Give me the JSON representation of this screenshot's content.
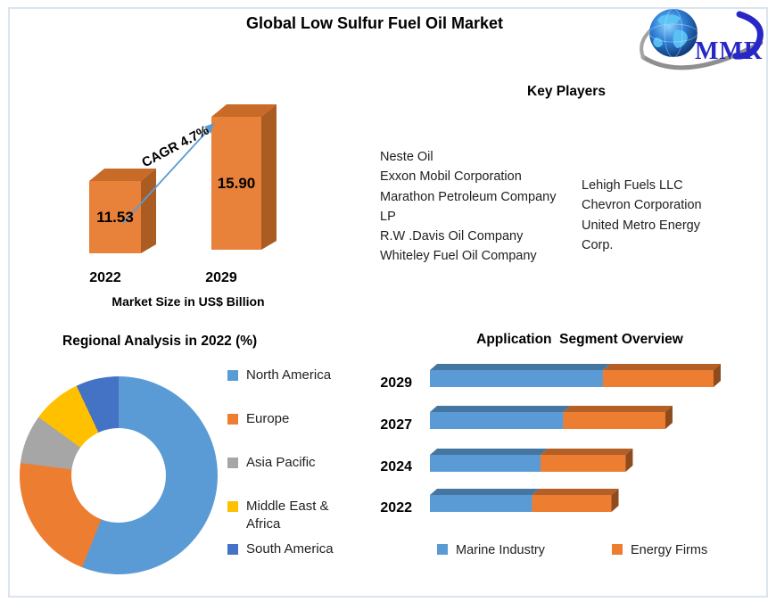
{
  "title": "Global Low Sulfur Fuel Oil Market",
  "logo": {
    "text": "MMR"
  },
  "colors": {
    "bar_front": "#e8813a",
    "bar_top": "#c86a28",
    "bar_side": "#ab5c22",
    "arrow": "#5b9bd5",
    "border": "#dbe4f0",
    "logo_blue": "#2727c8"
  },
  "key_players": {
    "heading": "Key Players",
    "left": [
      "Neste Oil",
      "Exxon Mobil Corporation",
      "Marathon Petroleum Company LP",
      "R.W .Davis Oil Company",
      "Whiteley Fuel Oil Company"
    ],
    "right": [
      "Lehigh Fuels LLC",
      "Chevron Corporation",
      "United Metro Energy Corp."
    ]
  },
  "chart_data": [
    {
      "type": "bar",
      "title": "Market Size in US$ Billion",
      "categories": [
        "2022",
        "2029"
      ],
      "values": [
        11.53,
        15.9
      ],
      "value_labels": [
        "11.53",
        "15.90"
      ],
      "annotation": "CAGR 4.7%",
      "bar_color": "#e8813a",
      "legend_position": "none"
    },
    {
      "type": "pie",
      "donut": true,
      "title": "Regional Analysis in 2022 (%)",
      "labels": [
        "North America",
        "Europe",
        "Asia Pacific",
        "Middle East & Africa",
        "South America"
      ],
      "values": [
        56,
        21,
        8,
        8,
        7
      ],
      "colors": [
        "#5b9bd5",
        "#ed7d31",
        "#a6a6a6",
        "#ffc000",
        "#4472c4"
      ],
      "legend_position": "right"
    },
    {
      "type": "bar",
      "orientation": "horizontal",
      "stacked": true,
      "title": "Application  Segment Overview",
      "categories": [
        "2029",
        "2027",
        "2024",
        "2022"
      ],
      "series": [
        {
          "name": "Marine Industry",
          "color": "#5b9bd5",
          "values": [
            61,
            47,
            39,
            36
          ]
        },
        {
          "name": "Energy Firms",
          "color": "#ed7d31",
          "values": [
            39,
            36,
            30,
            28
          ]
        }
      ],
      "legend_position": "bottom"
    }
  ]
}
